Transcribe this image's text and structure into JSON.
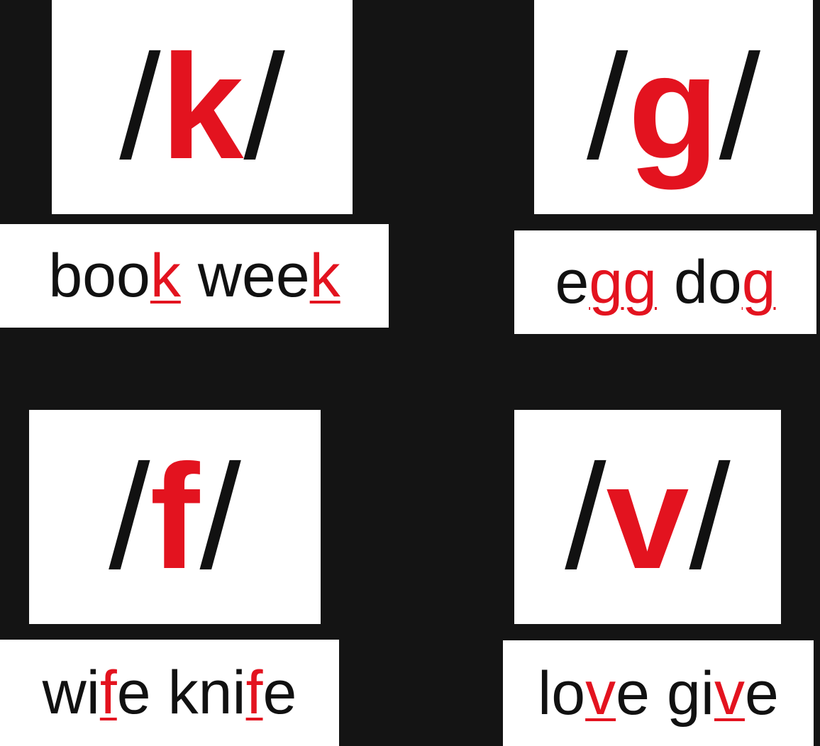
{
  "cards": [
    {
      "phoneme": {
        "open": "/",
        "sound": "k",
        "close": "/"
      },
      "words": [
        {
          "pre": "boo",
          "hl": "k",
          "post": ""
        },
        {
          "pre": "wee",
          "hl": "k",
          "post": ""
        }
      ]
    },
    {
      "phoneme": {
        "open": "/",
        "sound": "g",
        "close": "/"
      },
      "words": [
        {
          "pre": "e",
          "hl": "gg",
          "post": ""
        },
        {
          "pre": "do",
          "hl": "g",
          "post": ""
        }
      ]
    },
    {
      "phoneme": {
        "open": "/",
        "sound": "f",
        "close": "/"
      },
      "words": [
        {
          "pre": "wi",
          "hl": "f",
          "post": "e"
        },
        {
          "pre": "kni",
          "hl": "f",
          "post": "e"
        }
      ]
    },
    {
      "phoneme": {
        "open": "/",
        "sound": "v",
        "close": "/"
      },
      "words": [
        {
          "pre": "lo",
          "hl": "v",
          "post": "e"
        },
        {
          "pre": "gi",
          "hl": "v",
          "post": "e"
        }
      ]
    }
  ],
  "colors": {
    "background": "#141414",
    "card": "#ffffff",
    "accent": "#e3131f",
    "text": "#111111"
  }
}
